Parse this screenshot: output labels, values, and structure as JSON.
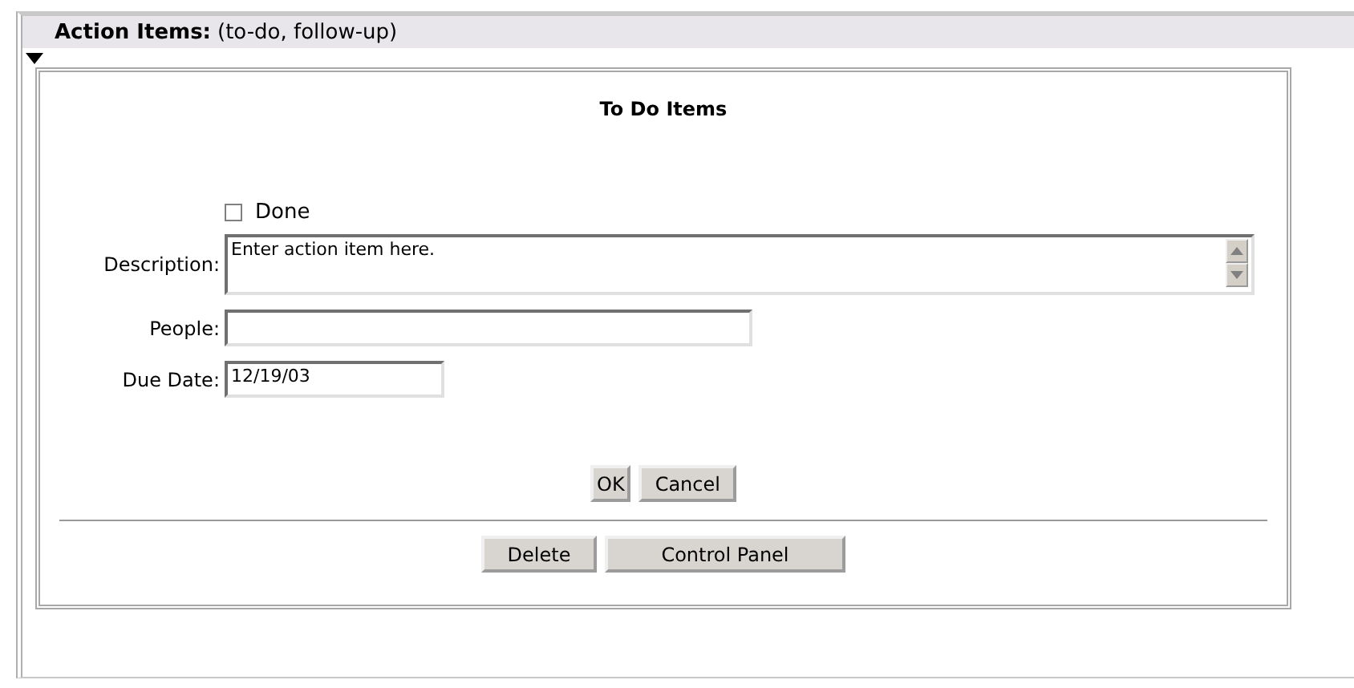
{
  "section": {
    "title": "Action Items:",
    "subtitle": "(to-do, follow-up)",
    "expanded": true
  },
  "form": {
    "title": "To Do Items",
    "done": {
      "label": "Done",
      "checked": false
    },
    "fields": [
      {
        "kind": "textarea",
        "label": "Description:",
        "value": "Enter action item here."
      },
      {
        "kind": "text",
        "label": "People:"
      },
      {
        "kind": "date",
        "label": "Due Date:",
        "value": "12/19/03"
      }
    ],
    "dialog_buttons": [
      "OK",
      "Cancel"
    ],
    "panel_buttons": [
      "Delete",
      "Control Panel"
    ]
  }
}
